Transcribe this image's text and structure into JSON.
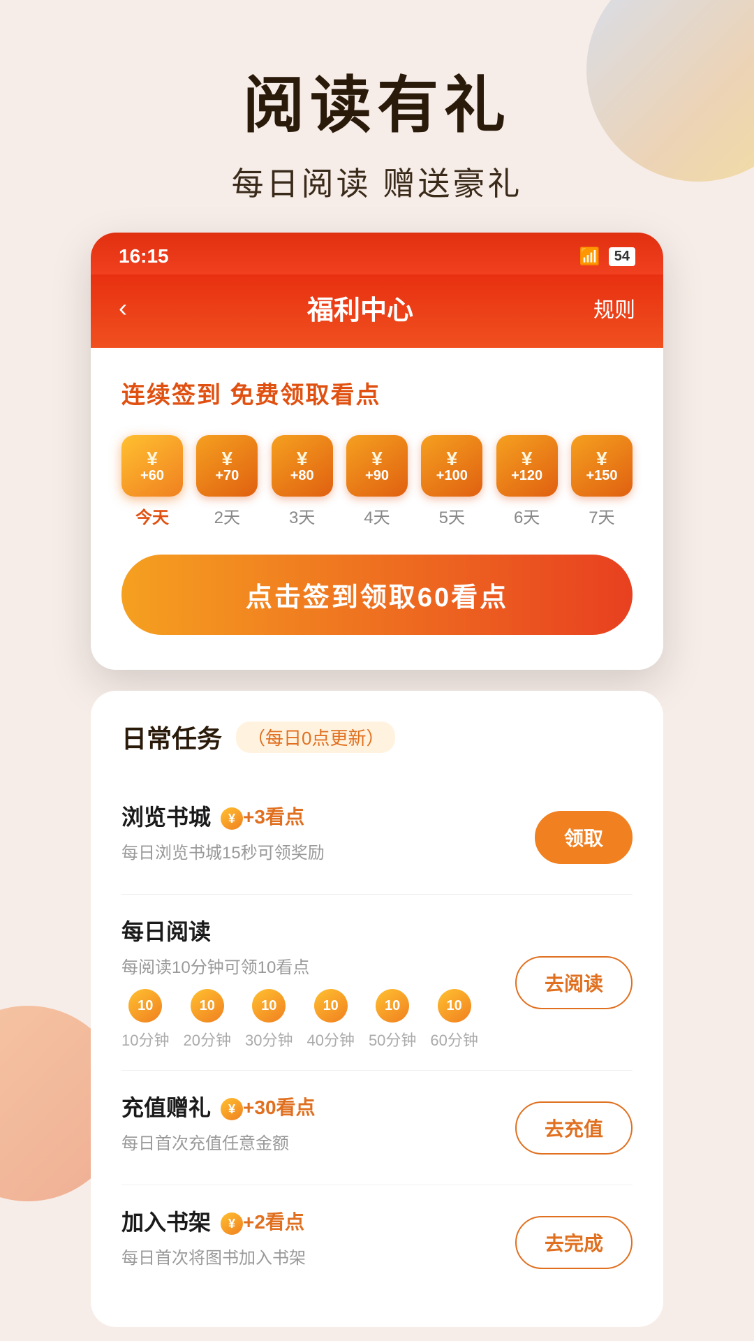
{
  "hero": {
    "title": "阅读有礼",
    "subtitle": "每日阅读  赠送豪礼"
  },
  "statusBar": {
    "time": "16:15",
    "wifi": "WiFi",
    "battery": "54"
  },
  "navBar": {
    "back": "‹",
    "title": "福利中心",
    "rules": "规则"
  },
  "signin": {
    "title": "连续签到 免费领取看点",
    "days": [
      {
        "amount": "+60",
        "label": "今天",
        "isToday": true
      },
      {
        "amount": "+70",
        "label": "2天",
        "isToday": false
      },
      {
        "amount": "+80",
        "label": "3天",
        "isToday": false
      },
      {
        "amount": "+90",
        "label": "4天",
        "isToday": false
      },
      {
        "amount": "+100",
        "label": "5天",
        "isToday": false
      },
      {
        "amount": "+120",
        "label": "6天",
        "isToday": false
      },
      {
        "amount": "+150",
        "label": "7天",
        "isToday": false
      }
    ],
    "buttonText": "点击签到领取60看点"
  },
  "tasks": {
    "title": "日常任务",
    "update": "（每日0点更新）",
    "items": [
      {
        "name": "浏览书城",
        "points": "⊙+3看点",
        "desc": "每日浏览书城15秒可领奖励",
        "btnText": "领取",
        "btnStyle": "filled",
        "hasProgress": false
      },
      {
        "name": "每日阅读",
        "points": "",
        "desc": "每阅读10分钟可领10看点",
        "btnText": "去阅读",
        "btnStyle": "outline",
        "hasProgress": true,
        "progressItems": [
          {
            "value": "10",
            "label": "10分钟"
          },
          {
            "value": "10",
            "label": "20分钟"
          },
          {
            "value": "10",
            "label": "30分钟"
          },
          {
            "value": "10",
            "label": "40分钟"
          },
          {
            "value": "10",
            "label": "50分钟"
          },
          {
            "value": "10",
            "label": "60分钟"
          }
        ]
      },
      {
        "name": "充值赠礼",
        "points": "⊙+30看点",
        "desc": "每日首次充值任意金额",
        "btnText": "去充值",
        "btnStyle": "outline",
        "hasProgress": false
      },
      {
        "name": "加入书架",
        "points": "⊙+2看点",
        "desc": "每日首次将图书加入书架",
        "btnText": "去完成",
        "btnStyle": "done",
        "hasProgress": false
      }
    ]
  }
}
